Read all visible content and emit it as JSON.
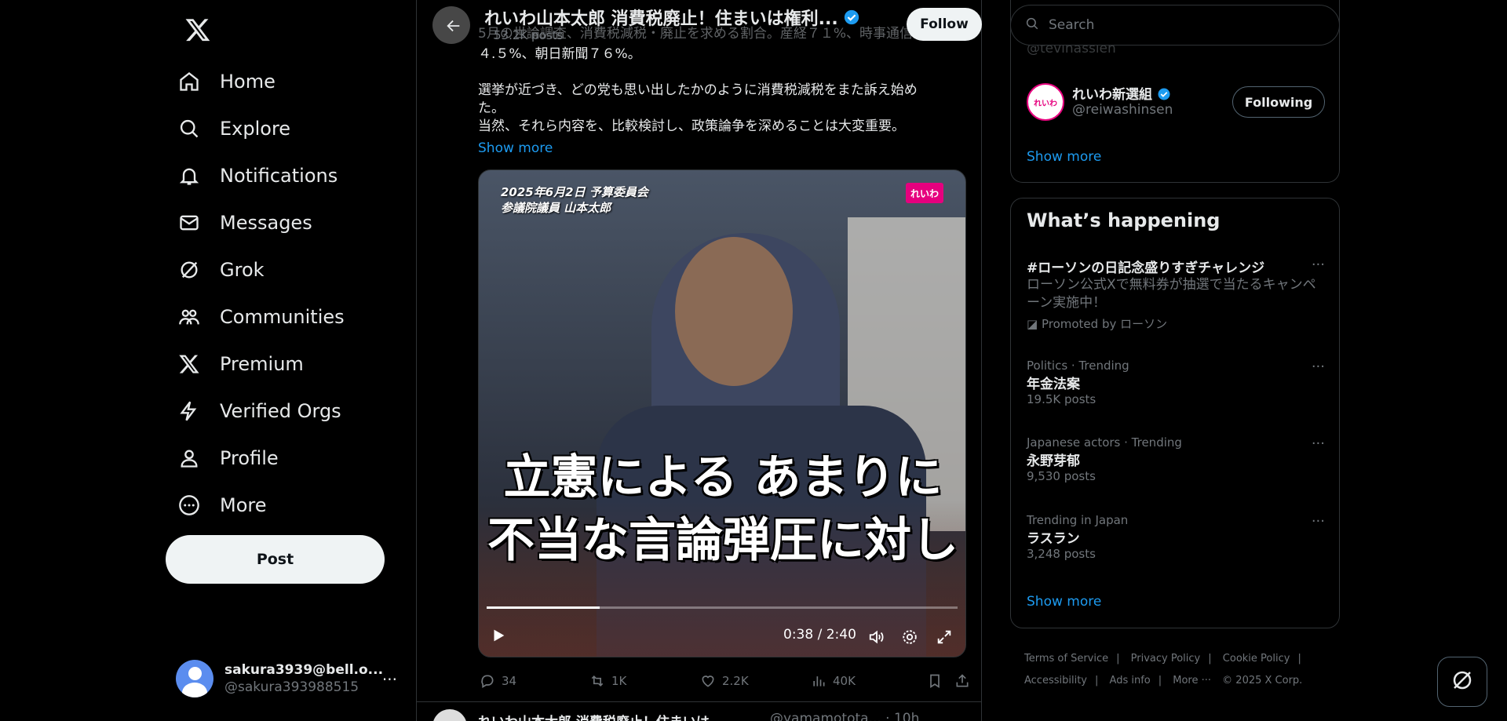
{
  "nav": {
    "items": [
      {
        "label": "Home"
      },
      {
        "label": "Explore"
      },
      {
        "label": "Notifications"
      },
      {
        "label": "Messages"
      },
      {
        "label": "Grok"
      },
      {
        "label": "Communities"
      },
      {
        "label": "Premium"
      },
      {
        "label": "Verified Orgs"
      },
      {
        "label": "Profile"
      },
      {
        "label": "More"
      }
    ],
    "post_label": "Post"
  },
  "account": {
    "name": "sakura3939@bell.o...",
    "handle": "@sakura393988515"
  },
  "header": {
    "title": "れいわ山本太郎 消費税廃止！住まいは権利...",
    "subtitle": "53.2K posts",
    "follow_label": "Follow"
  },
  "tweet": {
    "overlap_text": "5月の世論調査、消費税減税・廃止を求める割合。産経７１%、時事通信",
    "lines": [
      "４.５%、朝日新聞７６%。",
      "",
      "選挙が近づき、どの党も思い出したかのように消費税減税をまた訴え始め",
      "た。",
      "当然、それら内容を、比較検討し、政策論争を深めることは大変重要。"
    ],
    "show_more": "Show more"
  },
  "video": {
    "caption_line1": "2025年6月2日 予算委員会",
    "caption_line2": "参議院議員 山本太郎",
    "badge": "れいわ",
    "big_line1": "立憲による あまりに",
    "big_line2": "不当な言論弾圧に対し",
    "timecode": "0:38 / 2:40",
    "progress": 0.24
  },
  "actions": {
    "replies": "34",
    "reposts": "1K",
    "likes": "2.2K",
    "views": "40K"
  },
  "next_tweet": {
    "title": "れいわ山本太郎 消費税廃止！住まいは...",
    "meta": "@yamamotota... · 10h"
  },
  "search": {
    "placeholder": "Search"
  },
  "who_to_follow": {
    "prev_handle": "@tevinassien",
    "account_name": "れいわ新選組",
    "account_handle": "@reiwashinsen",
    "following_label": "Following",
    "show_more": "Show more"
  },
  "trends": {
    "heading": "What’s happening",
    "items": [
      {
        "name": "#ローソンの日記念盛りすぎチャレンジ",
        "desc": "ローソン公式Xで無料券が抽選で当たるキャンペーン実施中！",
        "promo": "Promoted by ローソン"
      },
      {
        "meta": "Politics · Trending",
        "name": "年金法案",
        "posts": "19.5K posts"
      },
      {
        "meta": "Japanese actors · Trending",
        "name": "永野芽郁",
        "posts": "9,530 posts"
      },
      {
        "meta": "Trending in Japan",
        "name": "ラスラン",
        "posts": "3,248 posts"
      }
    ],
    "show_more": "Show more"
  },
  "footer": {
    "links": [
      "Terms of Service",
      "Privacy Policy",
      "Cookie Policy",
      "Accessibility",
      "Ads info",
      "More ···"
    ],
    "copyright": "© 2025 X Corp."
  },
  "colors": {
    "accent": "#1d9bf0",
    "background": "#000000",
    "text": "#e7e9ea",
    "muted": "#71767b",
    "border": "#2f3336"
  }
}
